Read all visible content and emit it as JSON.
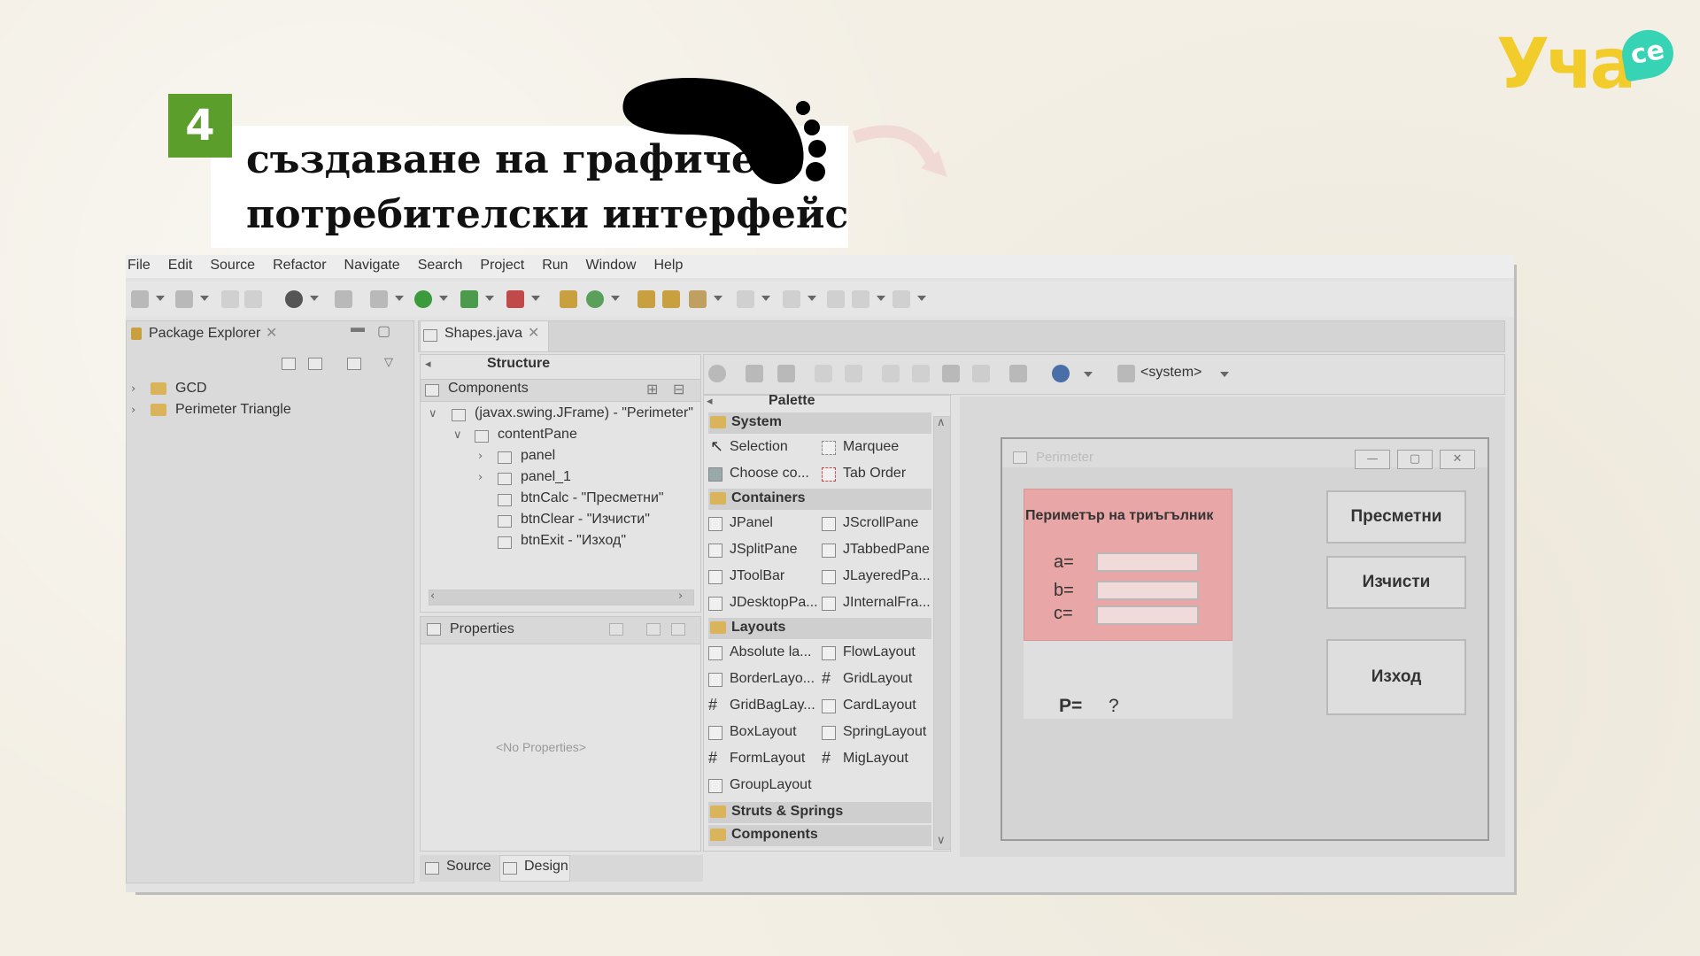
{
  "logo": {
    "main": "Уча",
    "bubble": "се"
  },
  "step": {
    "number": "4",
    "title_line1": "създаване на графичен",
    "title_line2": "потребителски интерфейс"
  },
  "menu": [
    "File",
    "Edit",
    "Source",
    "Refactor",
    "Navigate",
    "Search",
    "Project",
    "Run",
    "Window",
    "Help"
  ],
  "package_explorer": {
    "title": "Package Explorer",
    "items": [
      "GCD",
      "Perimeter Triangle"
    ]
  },
  "editor_tab": "Shapes.java",
  "structure": {
    "title": "Structure",
    "components_title": "Components",
    "tree": [
      "(javax.swing.JFrame) - \"Perimeter\"",
      "contentPane",
      "panel",
      "panel_1",
      "btnCalc - \"Пресметни\"",
      "btnClear - \"Изчисти\"",
      "btnExit - \"Изход\""
    ]
  },
  "properties": {
    "title": "Properties",
    "empty": "<No Properties>"
  },
  "palette": {
    "title": "Palette",
    "system_label": "<system>",
    "sections": {
      "system": "System",
      "containers": "Containers",
      "layouts": "Layouts",
      "struts": "Struts & Springs",
      "components": "Components"
    },
    "system_items": [
      "Selection",
      "Marquee",
      "Choose co...",
      "Tab Order"
    ],
    "container_items": [
      "JPanel",
      "JScrollPane",
      "JSplitPane",
      "JTabbedPane",
      "JToolBar",
      "JLayeredPa...",
      "JDesktopPa...",
      "JInternalFra..."
    ],
    "layout_items": [
      "Absolute la...",
      "FlowLayout",
      "BorderLayo...",
      "GridLayout",
      "GridBagLay...",
      "CardLayout",
      "BoxLayout",
      "SpringLayout",
      "FormLayout",
      "MigLayout",
      "GroupLayout"
    ]
  },
  "jframe": {
    "title": "Perimeter",
    "panel_title": "Периметър на триъгълник",
    "label_a": "a=",
    "label_b": "b=",
    "label_c": "c=",
    "result_label": "P=",
    "result_value": "?",
    "btn_calc": "Пресметни",
    "btn_clear": "Изчисти",
    "btn_exit": "Изход"
  },
  "bottom_tabs": {
    "source": "Source",
    "design": "Design"
  }
}
